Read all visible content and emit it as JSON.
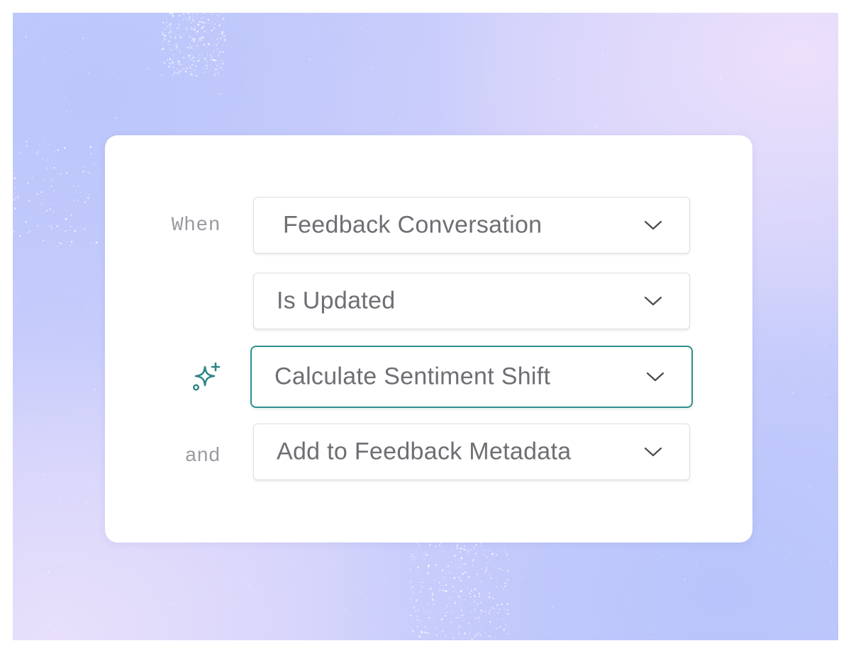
{
  "colors": {
    "accent": "#2f8f8f",
    "text": "#6e6e74",
    "label": "#9a9aa2",
    "card": "#ffffff"
  },
  "rows": [
    {
      "label": "When",
      "value": "Feedback Conversation",
      "icon": "chevron-down-icon"
    },
    {
      "label": "",
      "value": "Is Updated",
      "icon": "chevron-down-icon"
    },
    {
      "label_icon": "sparkle-ai-icon",
      "value": "Calculate Sentiment Shift",
      "icon": "chevron-down-icon",
      "active": true
    },
    {
      "label": "and",
      "value": "Add to Feedback Metadata",
      "icon": "chevron-down-icon"
    }
  ]
}
